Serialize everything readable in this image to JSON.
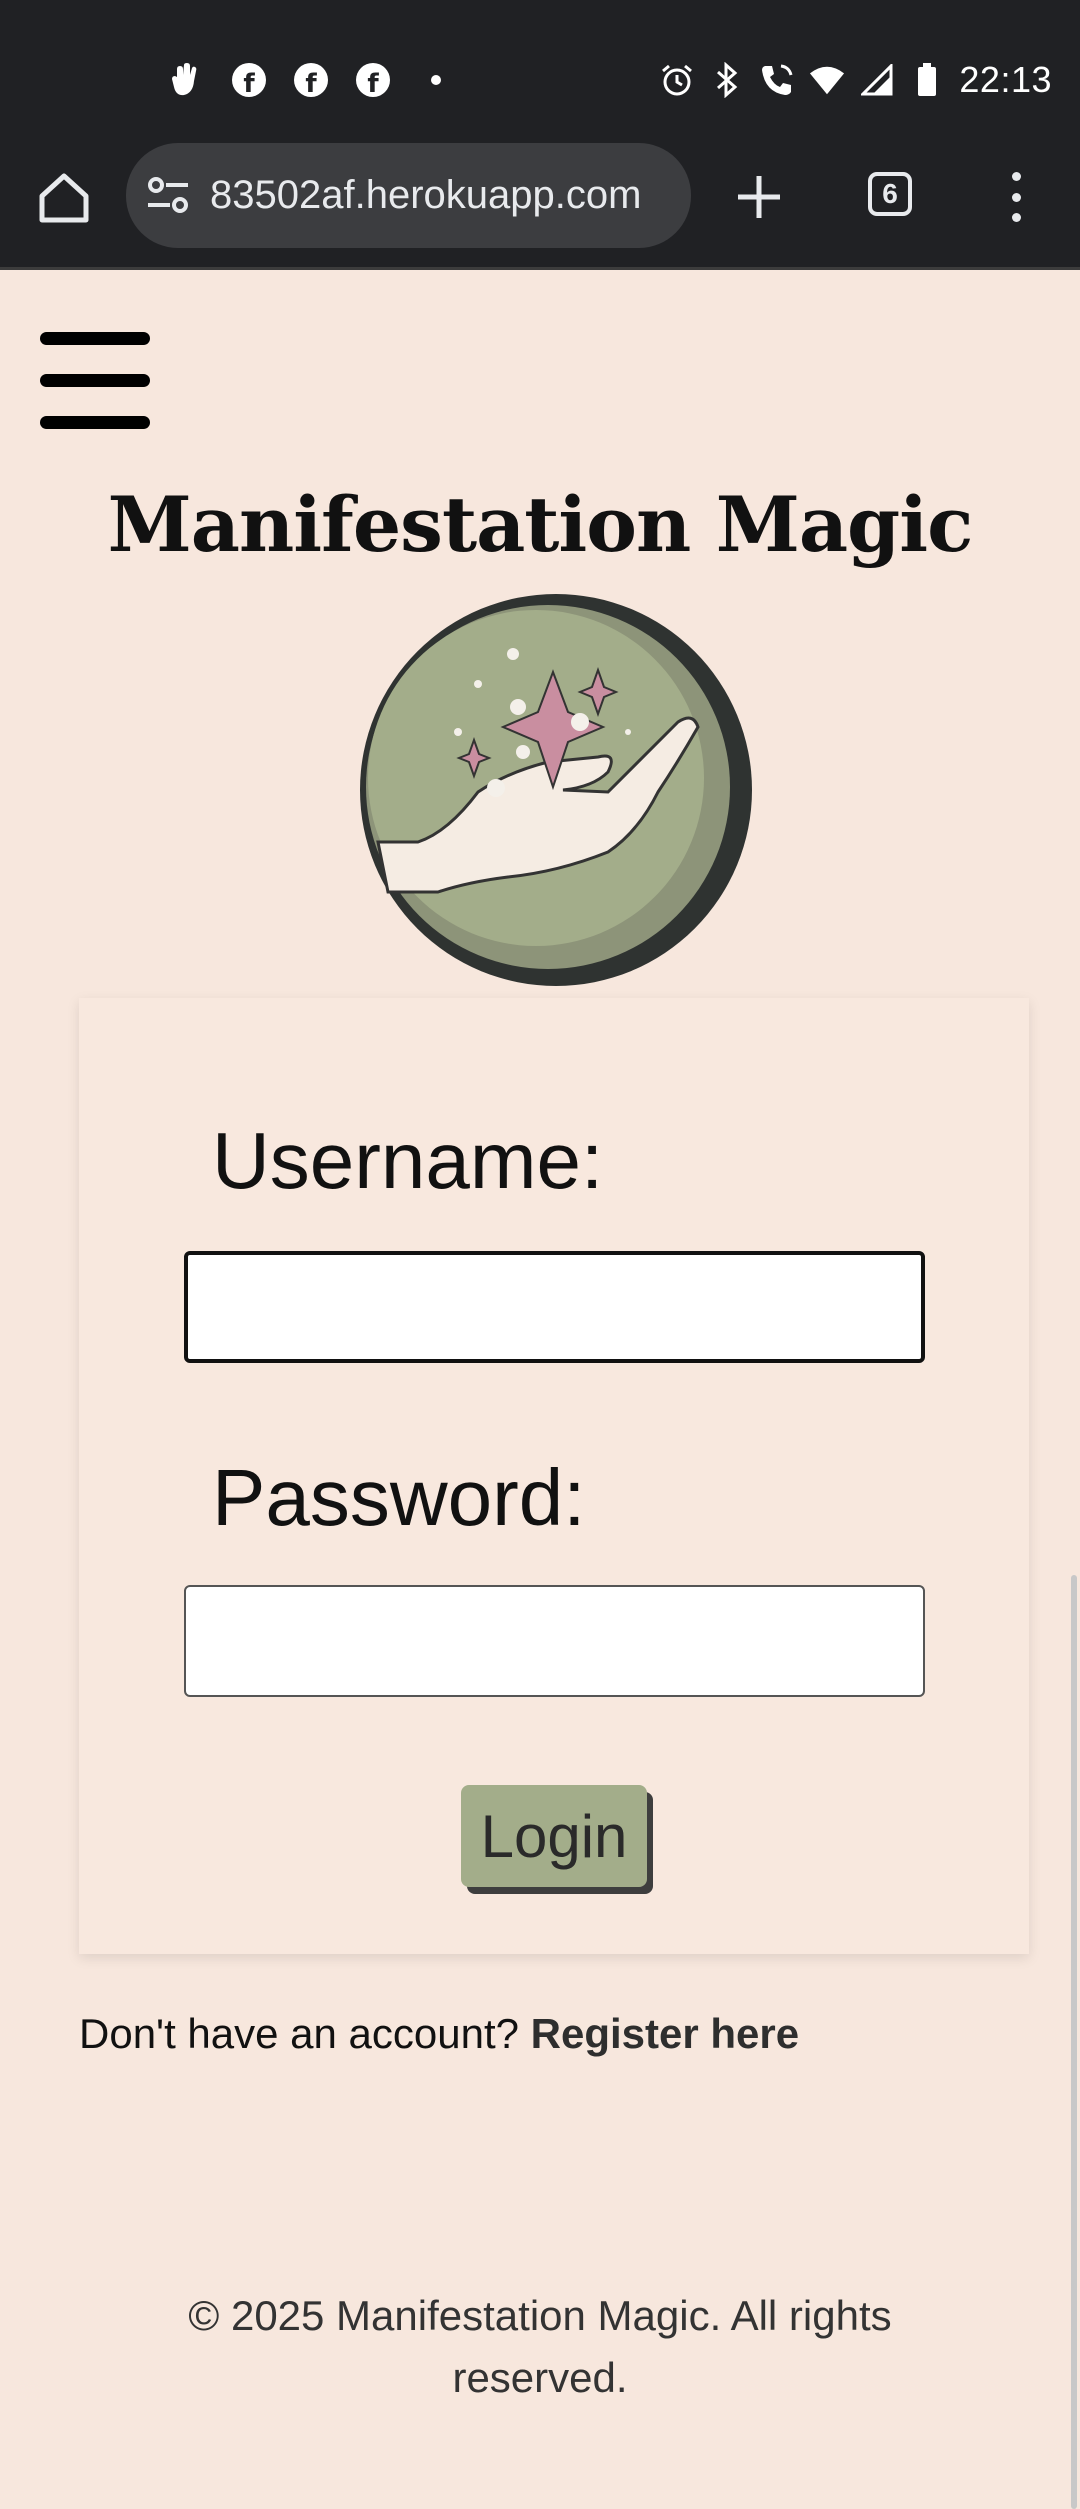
{
  "status_bar": {
    "time": "22:13",
    "notification_icons": [
      "hand-wave-icon",
      "facebook-icon",
      "facebook-icon",
      "facebook-icon",
      "more-dot-icon"
    ],
    "system_icons": [
      "alarm-icon",
      "bluetooth-icon",
      "wifi-call-icon",
      "wifi-icon",
      "signal-icon",
      "battery-icon"
    ]
  },
  "browser": {
    "url": "83502af.herokuapp.com",
    "tab_count": "6"
  },
  "page": {
    "site_title": "Manifestation Magic",
    "username_label": "Username:",
    "username_value": "",
    "password_label": "Password:",
    "password_value": "",
    "login_button": "Login",
    "register_prompt": "Don't have an account?",
    "register_link": "Register here",
    "footer_line1": "© 2025 Manifestation Magic. All rights",
    "footer_line2": "reserved."
  },
  "colors": {
    "page_background": "#f7e7dd",
    "button_background": "#a3ad8a",
    "orb_green": "#a3ad8a",
    "sparkle_pink": "#c98ea0",
    "browser_chrome": "#202124"
  }
}
